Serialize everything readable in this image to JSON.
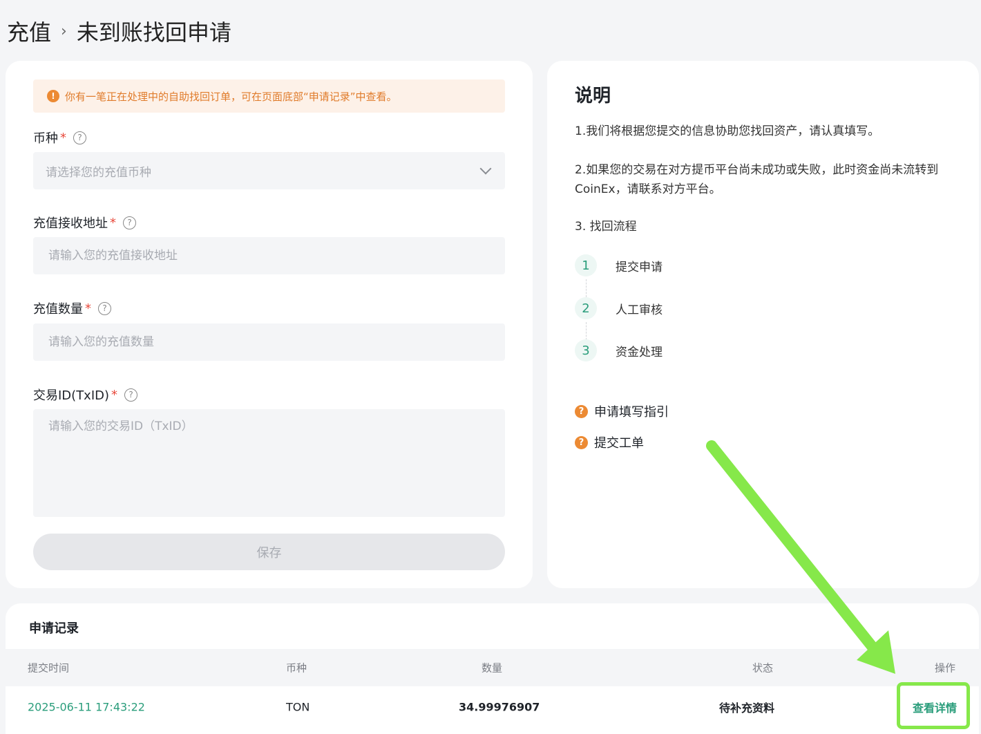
{
  "breadcrumb": {
    "parent": "充值",
    "separator": "›",
    "current": "未到账找回申请"
  },
  "form": {
    "notice": "你有一笔正在处理中的自助找回订单，可在页面底部“申请记录”中查看。",
    "coin": {
      "label": "币种",
      "placeholder": "请选择您的充值币种"
    },
    "address": {
      "label": "充值接收地址",
      "placeholder": "请输入您的充值接收地址"
    },
    "amount": {
      "label": "充值数量",
      "placeholder": "请输入您的充值数量"
    },
    "txid": {
      "label": "交易ID(TxID)",
      "placeholder": "请输入您的交易ID（TxID）"
    },
    "required_mark": "*",
    "help_mark": "?",
    "save_label": "保存"
  },
  "info": {
    "title": "说明",
    "p1": "1.我们将根据您提交的信息协助您找回资产，请认真填写。",
    "p2": "2.如果您的交易在对方提币平台尚未成功或失败，此时资金尚未流转到CoinEx，请联系对方平台。",
    "p3": "3. 找回流程",
    "steps": [
      {
        "num": "1",
        "label": "提交申请"
      },
      {
        "num": "2",
        "label": "人工审核"
      },
      {
        "num": "3",
        "label": "资金处理"
      }
    ],
    "links": [
      {
        "icon": "?",
        "label": "申请填写指引"
      },
      {
        "icon": "?",
        "label": "提交工单"
      }
    ]
  },
  "records": {
    "title": "申请记录",
    "columns": {
      "time": "提交时间",
      "coin": "币种",
      "amount": "数量",
      "status": "状态",
      "action": "操作"
    },
    "rows": [
      {
        "time": "2025-06-11 17:43:22",
        "coin": "TON",
        "amount": "34.99976907",
        "status": "待补充资料",
        "action": "查看详情"
      }
    ]
  },
  "colors": {
    "accent": "#2a9d7b",
    "warning": "#ec8a33",
    "annotation": "#86e84a"
  }
}
